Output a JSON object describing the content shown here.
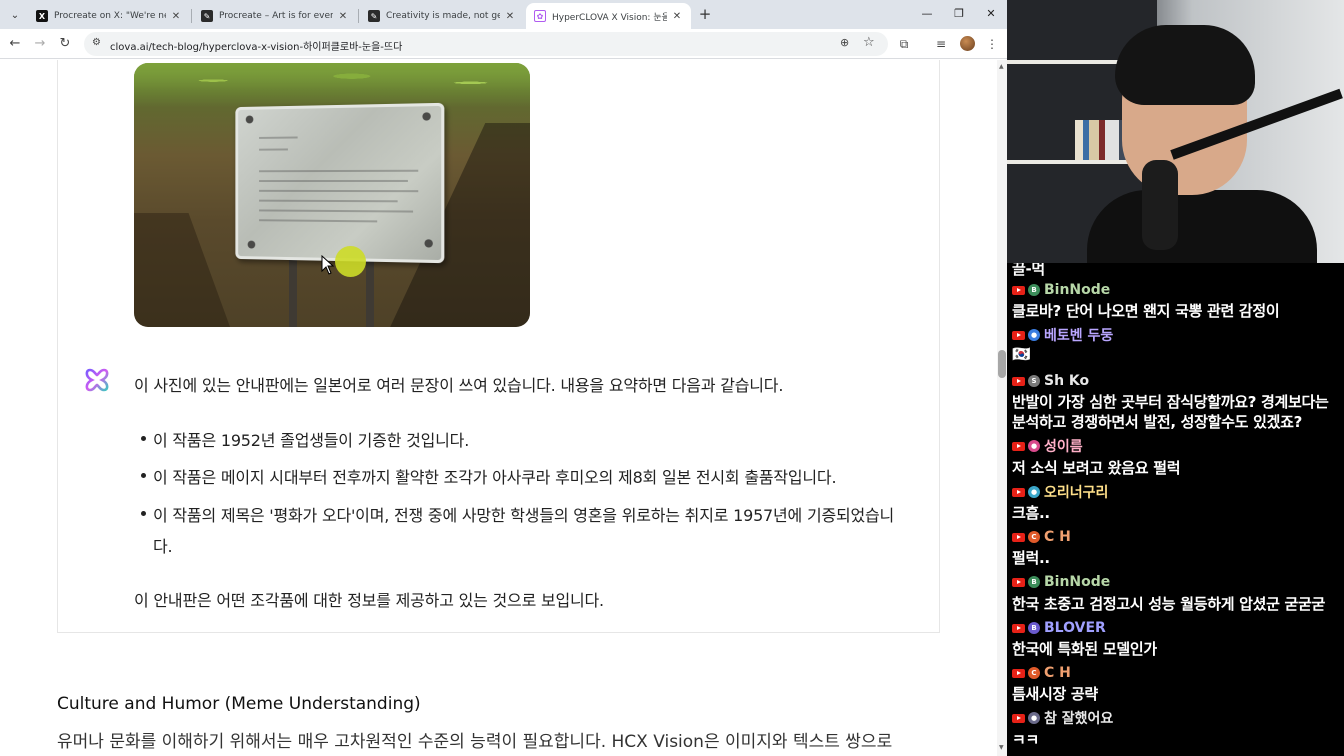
{
  "browser": {
    "tabs": [
      {
        "title": "Procreate on X: \"We're never g",
        "favicon_color": "#111111",
        "favicon_glyph": "X"
      },
      {
        "title": "Procreate – Art is for everyone",
        "favicon_color": "#2b2b2b",
        "favicon_glyph": "✎"
      },
      {
        "title": "Creativity is made, not generat",
        "favicon_color": "#2b2b2b",
        "favicon_glyph": "✎"
      },
      {
        "title": "HyperCLOVA X Vision: 눈을 뜨",
        "favicon_color": "#ffffff",
        "favicon_glyph": "✿"
      }
    ],
    "url": "clova.ai/tech-blog/hyperclova-x-vision-하이퍼클로바-눈을-뜨다"
  },
  "article": {
    "answer_intro": "이 사진에 있는 안내판에는 일본어로 여러 문장이 쓰여 있습니다. 내용을 요약하면 다음과 같습니다.",
    "bullets": [
      "이 작품은 1952년 졸업생들이 기증한 것입니다.",
      "이 작품은 메이지 시대부터 전후까지 활약한 조각가 아사쿠라 후미오의 제8회 일본 전시회 출품작입니다.",
      "이 작품의 제목은 '평화가 오다'이며, 전쟁 중에 사망한 학생들의 영혼을 위로하는 취지로 1957년에 기증되었습니"
    ],
    "bullet3_cont": "다.",
    "answer_conclusion": "이 안내판은 어떤 조각품에 대한 정보를 제공하고 있는 것으로 보입니다.",
    "section_title": "Culture and Humor (Meme Understanding)",
    "section_body": "유머나 문화를 이해하기 위해서는 매우 고차원적인 수준의 능력이 필요합니다. HCX Vision은 이미지와 텍스트 쌍으로"
  },
  "chat": {
    "partial_top": "끌-먹",
    "messages": [
      {
        "name": "BinNode",
        "name_color": "#b7d7a8",
        "badge_color": "#3c8d5a",
        "badge": "B",
        "text": "클로바? 단어 나오면 왠지 국뽕 관련 감정이"
      },
      {
        "name": "베토벤 두둥",
        "name_color": "#b9a6ff",
        "badge_color": "#3b7de0",
        "badge": "●",
        "text": "🇰🇷"
      },
      {
        "name": "Sh Ko",
        "name_color": "#e8e8e8",
        "badge_color": "#7a7a7a",
        "badge": "S",
        "text": "반발이 가장 심한 곳부터 잠식당할까요? 경계보다는",
        "text2": "분석하고 경쟁하면서 발전, 성장할수도 있겠죠?"
      },
      {
        "name": "성이름",
        "name_color": "#ffb0c8",
        "badge_color": "#d94a8c",
        "badge": "●",
        "text": "저 소식 보려고 왔음요 펄럭"
      },
      {
        "name": "오리너구리",
        "name_color": "#ffe08a",
        "badge_color": "#3aa6c9",
        "badge": "●",
        "text": "크흠.."
      },
      {
        "name": "C H",
        "name_color": "#f0a070",
        "badge_color": "#e05a2a",
        "badge": "C",
        "text": "펄럭.."
      },
      {
        "name": "BinNode",
        "name_color": "#b7d7a8",
        "badge_color": "#3c8d5a",
        "badge": "B",
        "text": "한국 초중고 검정고시 성능 월등하게 압셨군 굳굳굳"
      },
      {
        "name": "BLOVER",
        "name_color": "#a0a0ff",
        "badge_color": "#6a5acd",
        "badge": "B",
        "text": "한국에 특화된 모델인가"
      },
      {
        "name": "C H",
        "name_color": "#f0a070",
        "badge_color": "#e05a2a",
        "badge": "C",
        "text": "틈새시장 공략"
      },
      {
        "name": "참 잘했어요",
        "name_color": "#e8e8e8",
        "badge_color": "#6a6a8a",
        "badge": "●",
        "text": "ㅋㅋ"
      }
    ]
  }
}
